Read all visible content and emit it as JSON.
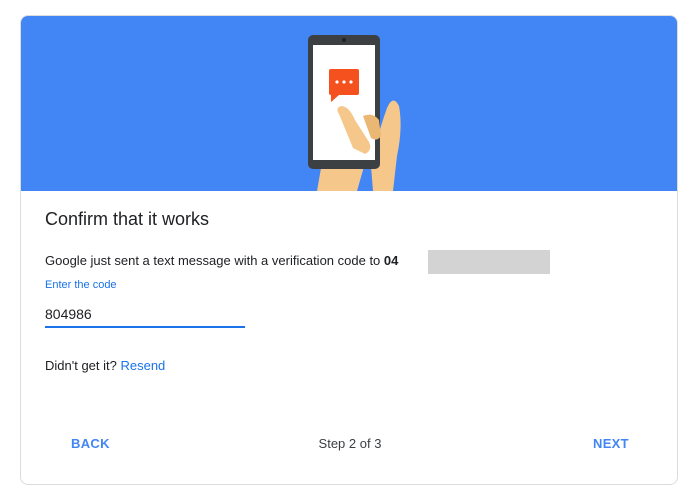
{
  "dialog": {
    "title": "Confirm that it works",
    "message_prefix": "Google just sent a text message with a verification code to ",
    "phone_visible": "04",
    "code_label": "Enter the code",
    "code_value": "804986",
    "didnt_get_prefix": "Didn't get it? ",
    "resend_label": "Resend",
    "back_label": "BACK",
    "step_text": "Step 2 of 3",
    "next_label": "NEXT"
  },
  "colors": {
    "hero_background": "#4285f4",
    "accent": "#1a73e8",
    "chat_bubble": "#f4511e",
    "redaction": "#d3d3d3"
  },
  "icons": {
    "hero": "hand-holding-phone-illustration",
    "message": "chat-bubble-icon"
  }
}
